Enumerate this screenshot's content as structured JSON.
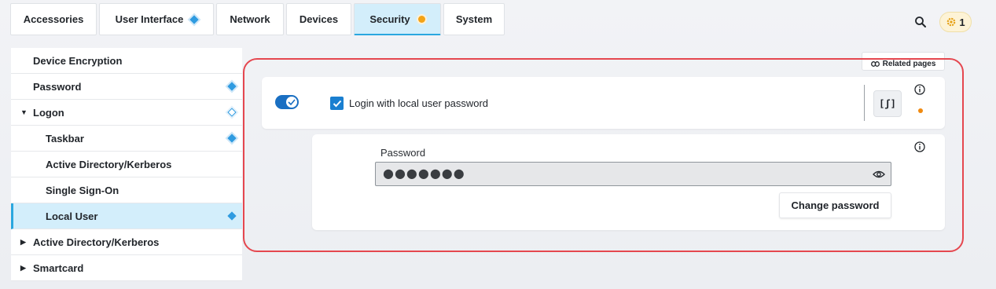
{
  "tabs": [
    {
      "label": "Accessories"
    },
    {
      "label": "User Interface"
    },
    {
      "label": "Network"
    },
    {
      "label": "Devices"
    },
    {
      "label": "Security"
    },
    {
      "label": "System"
    }
  ],
  "header": {
    "notification_count": "1"
  },
  "sidebar": {
    "items": [
      {
        "label": "Device Encryption"
      },
      {
        "label": "Password"
      },
      {
        "label": "Logon"
      },
      {
        "label": "Taskbar"
      },
      {
        "label": "Active Directory/Kerberos"
      },
      {
        "label": "Single Sign-On"
      },
      {
        "label": "Local User"
      },
      {
        "label": "Active Directory/Kerberos"
      },
      {
        "label": "Smartcard"
      }
    ]
  },
  "related": {
    "label": "Related pages"
  },
  "setting": {
    "checkbox_label": "Login with local user password",
    "checked": true,
    "toggle_on": true,
    "script_label": "[ʃ]"
  },
  "password": {
    "label": "Password",
    "value": "●●●●●●●",
    "change_label": "Change password"
  },
  "colors": {
    "accent": "#2aa7df",
    "active_tab_bg": "#d3eefb",
    "highlight": "#e5474f",
    "modified_dot": "#f3a316"
  }
}
